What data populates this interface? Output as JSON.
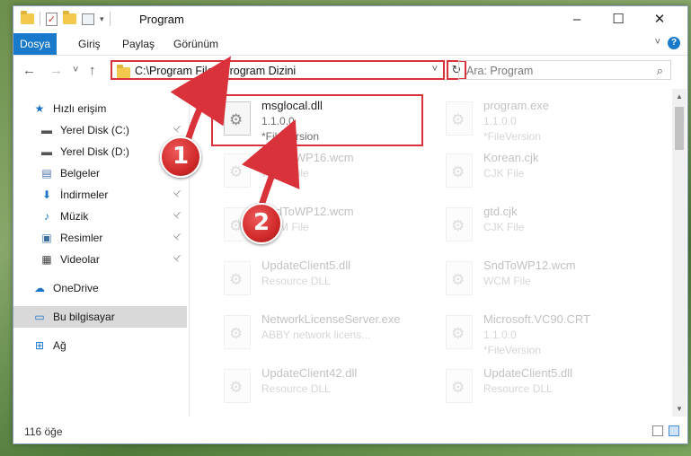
{
  "window": {
    "title": "Program",
    "controls": {
      "minimize": "–",
      "maximize": "☐",
      "close": "✕"
    }
  },
  "ribbon": {
    "tabs": [
      "Dosya",
      "Giriş",
      "Paylaş",
      "Görünüm"
    ],
    "help": "?"
  },
  "navigation": {
    "back": "←",
    "forward": "→",
    "recent": "˅",
    "up": "↑",
    "address": "C:\\Program Files\\Program Dizini",
    "refresh": "↻",
    "search_placeholder": "Ara: Program",
    "search_icon": "⌕"
  },
  "sidebar": {
    "items": [
      {
        "label": "Hızlı erişim",
        "icon": "star-icon",
        "glyph": "★",
        "color": "#1a73c8",
        "pinned": false
      },
      {
        "label": "Yerel Disk (C:)",
        "icon": "drive-icon",
        "glyph": "▬",
        "color": "#555555",
        "pinned": true
      },
      {
        "label": "Yerel Disk (D:)",
        "icon": "drive-icon",
        "glyph": "▬",
        "color": "#555555",
        "pinned": true
      },
      {
        "label": "Belgeler",
        "icon": "documents-icon",
        "glyph": "▤",
        "color": "#4a6fa5",
        "pinned": true
      },
      {
        "label": "İndirmeler",
        "icon": "download-icon",
        "glyph": "⬇",
        "color": "#1a73c8",
        "pinned": true
      },
      {
        "label": "Müzik",
        "icon": "music-icon",
        "glyph": "♪",
        "color": "#1a73c8",
        "pinned": true
      },
      {
        "label": "Resimler",
        "icon": "pictures-icon",
        "glyph": "▣",
        "color": "#3d6f9e",
        "pinned": true
      },
      {
        "label": "Videolar",
        "icon": "videos-icon",
        "glyph": "▦",
        "color": "#444444",
        "pinned": true
      },
      {
        "label": "OneDrive",
        "icon": "cloud-icon",
        "glyph": "☁",
        "color": "#1a73c8",
        "pinned": false
      },
      {
        "label": "Bu bilgisayar",
        "icon": "computer-icon",
        "glyph": "▭",
        "color": "#1a73c8",
        "pinned": false
      },
      {
        "label": "Ağ",
        "icon": "network-icon",
        "glyph": "⊞",
        "color": "#1a73c8",
        "pinned": false
      }
    ],
    "pin_glyph": "📌"
  },
  "files": [
    {
      "name": "msglocal.dll",
      "line2": "1.1.0.0",
      "line3": "*FileVersion",
      "faded": false
    },
    {
      "name": "program.exe",
      "line2": "1.1.0.0",
      "line3": "*FileVersion",
      "faded": true
    },
    {
      "name": "SndToWP16.wcm",
      "line2": "WCM File",
      "line3": "",
      "faded": true
    },
    {
      "name": "Korean.cjk",
      "line2": "CJK File",
      "line3": "",
      "faded": true
    },
    {
      "name": "SndToWP12.wcm",
      "line2": "WCM File",
      "line3": "",
      "faded": true
    },
    {
      "name": "gtd.cjk",
      "line2": "CJK File",
      "line3": "",
      "faded": true
    },
    {
      "name": "UpdateClient5.dll",
      "line2": "Resource DLL",
      "line3": "",
      "faded": true
    },
    {
      "name": "SndToWP12.wcm",
      "line2": "WCM File",
      "line3": "",
      "faded": true
    },
    {
      "name": "NetworkLicenseServer.exe",
      "line2": "ABBY network licens...",
      "line3": "",
      "faded": true
    },
    {
      "name": "Microsoft.VC90.CRT",
      "line2": "1.1.0.0",
      "line3": "*FileVersion",
      "faded": true
    },
    {
      "name": "UpdateClient42.dll",
      "line2": "Resource DLL",
      "line3": "",
      "faded": true
    },
    {
      "name": "UpdateClient5.dll",
      "line2": "Resource DLL",
      "line3": "",
      "faded": true
    }
  ],
  "status": {
    "item_count": "116 öğe"
  },
  "annotations": {
    "badge1": "1",
    "badge2": "2",
    "color": "#d9323a"
  }
}
